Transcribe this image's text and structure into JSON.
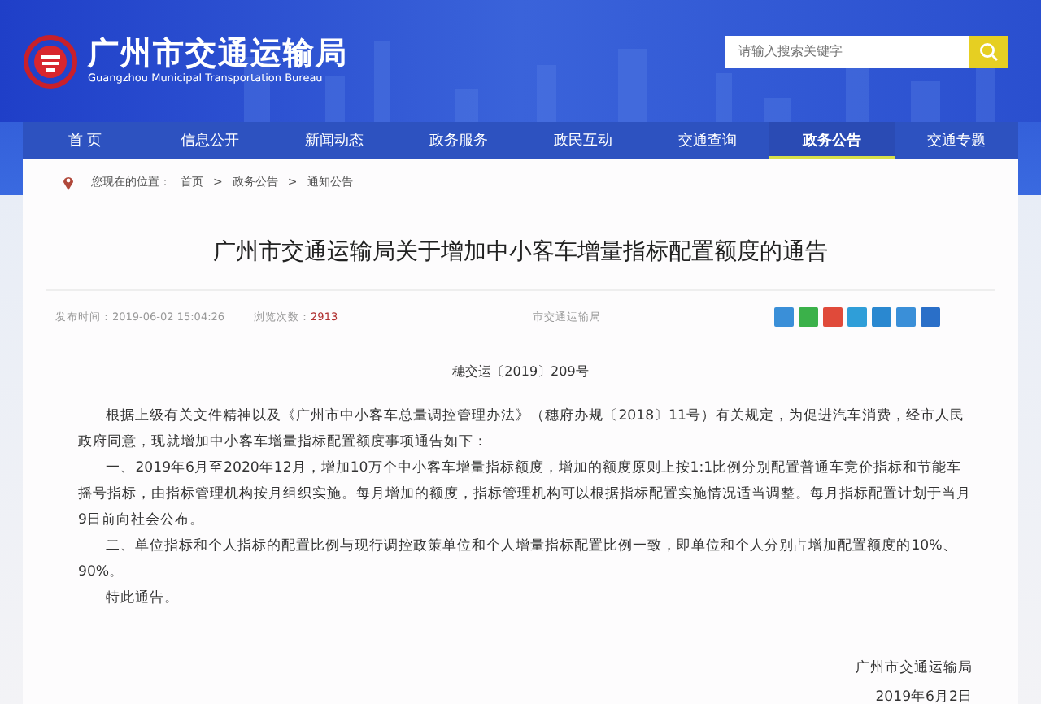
{
  "header": {
    "title": "广州市交通运输局",
    "subtitle": "Guangzhou Municipal Transportation Bureau",
    "search": {
      "placeholder": "请输入搜索关键字"
    }
  },
  "nav": [
    {
      "label": "首 页",
      "selected": false
    },
    {
      "label": "信息公开",
      "selected": false
    },
    {
      "label": "新闻动态",
      "selected": false
    },
    {
      "label": "政务服务",
      "selected": false
    },
    {
      "label": "政民互动",
      "selected": false
    },
    {
      "label": "交通查询",
      "selected": false
    },
    {
      "label": "政务公告",
      "selected": true
    },
    {
      "label": "交通专题",
      "selected": false
    }
  ],
  "breadcrumb": {
    "label": "您现在的位置：",
    "items": [
      "首页",
      "政务公告",
      "通知公告"
    ],
    "separator": ">"
  },
  "article": {
    "title": "广州市交通运输局关于增加中小客车增量指标配置额度的通告",
    "meta": {
      "published": "发布时间：2019-06-02 15:04:26",
      "views_label": "浏览次数：",
      "views": "2913",
      "source": "市交通运输局"
    },
    "share": [
      {
        "color": "#3a8fd8"
      },
      {
        "color": "#3bb14a"
      },
      {
        "color": "#e04a3a"
      },
      {
        "color": "#2f9ed8"
      },
      {
        "color": "#2a88d0"
      },
      {
        "color": "#3a8fd8"
      },
      {
        "color": "#2a6fc8"
      }
    ],
    "doc_number": "穗交运〔2019〕209号",
    "paragraphs": [
      {
        "text": "根据上级有关文件精神以及《广州市中小客车总量调控管理办法》（穗府办规〔2018〕11号）有关规定，为促进汽车消费，经市人民政府同意，现就增加中小客车增量指标配置额度事项通告如下："
      },
      {
        "text": "一、2019年6月至2020年12月，增加10万个中小客车增量指标额度，增加的额度原则上按1:1比例分别配置普通车竞价指标和节能车摇号指标，由指标管理机构按月组织实施。每月增加的额度，指标管理机构可以根据指标配置实施情况适当调整。每月指标配置计划于当月9日前向社会公布。"
      },
      {
        "text": "二、单位指标和个人指标的配置比例与现行调控政策单位和个人增量指标配置比例一致，即单位和个人分别占增加配置额度的10%、90%。"
      },
      {
        "text": "特此通告。"
      }
    ],
    "signature": {
      "issuer": "广州市交通运输局",
      "date": "2019年6月2日"
    }
  }
}
